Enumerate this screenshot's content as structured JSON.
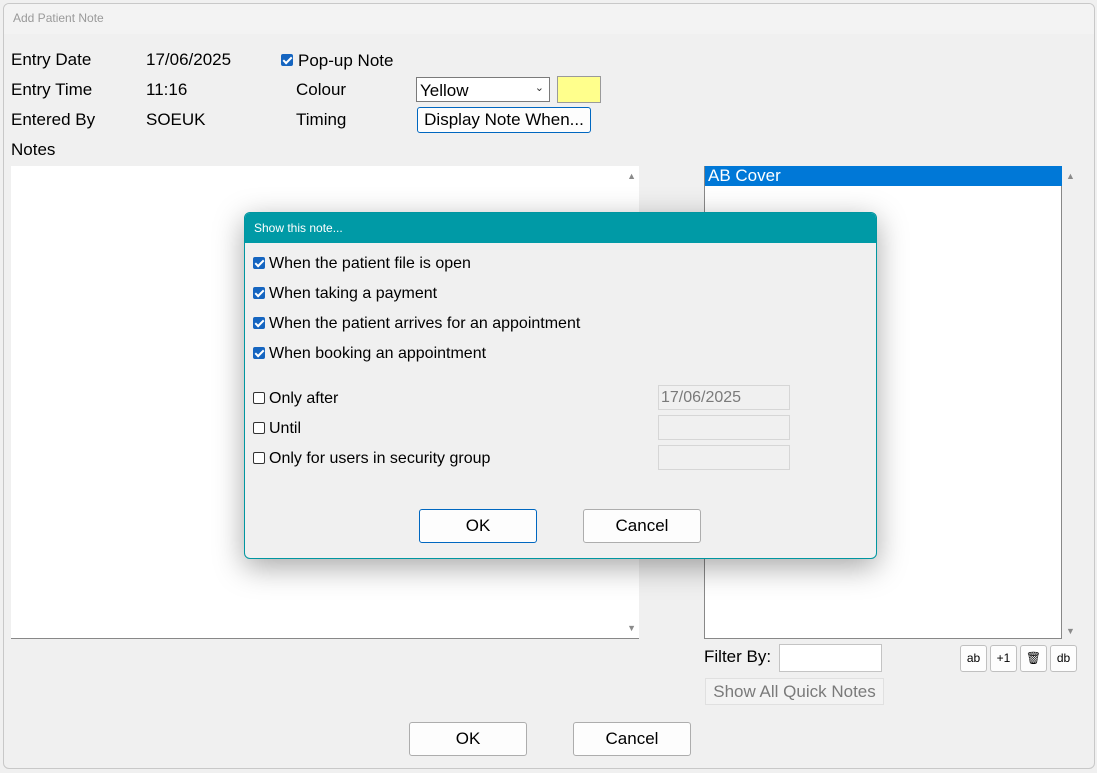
{
  "window": {
    "title": "Add Patient Note"
  },
  "form": {
    "entry_date_label": "Entry Date",
    "entry_date_value": "17/06/2025",
    "entry_time_label": "Entry Time",
    "entry_time_value": "11:16",
    "entered_by_label": "Entered By",
    "entered_by_value": "SOEUK",
    "popup_note_label": "Pop-up Note",
    "popup_note_checked": true,
    "colour_label": "Colour",
    "colour_value": "Yellow",
    "colour_swatch": "#ffff8c",
    "timing_label": "Timing",
    "timing_button": "Display Note When...",
    "notes_label": "Notes"
  },
  "quick_notes": {
    "items": [
      "AB Cover"
    ],
    "filter_label": "Filter By:",
    "filter_value": "",
    "show_all_label": "Show All Quick Notes",
    "tool_buttons": [
      "ab",
      "+1",
      "🗑",
      "db"
    ]
  },
  "footer": {
    "ok_label": "OK",
    "cancel_label": "Cancel"
  },
  "dialog": {
    "title": "Show this note...",
    "options": [
      {
        "label": "When the patient file is open",
        "checked": true
      },
      {
        "label": "When taking a payment",
        "checked": true
      },
      {
        "label": "When the patient arrives for an appointment",
        "checked": true
      },
      {
        "label": "When booking an appointment",
        "checked": true
      }
    ],
    "only_after_label": "Only after",
    "only_after_value": "17/06/2025",
    "until_label": "Until",
    "until_value": "",
    "security_group_label": "Only for users in security group",
    "security_group_value": "",
    "ok_label": "OK",
    "cancel_label": "Cancel"
  },
  "colors": {
    "accent": "#009aa6",
    "selection": "#0078d7",
    "checkbox": "#1565c0"
  }
}
